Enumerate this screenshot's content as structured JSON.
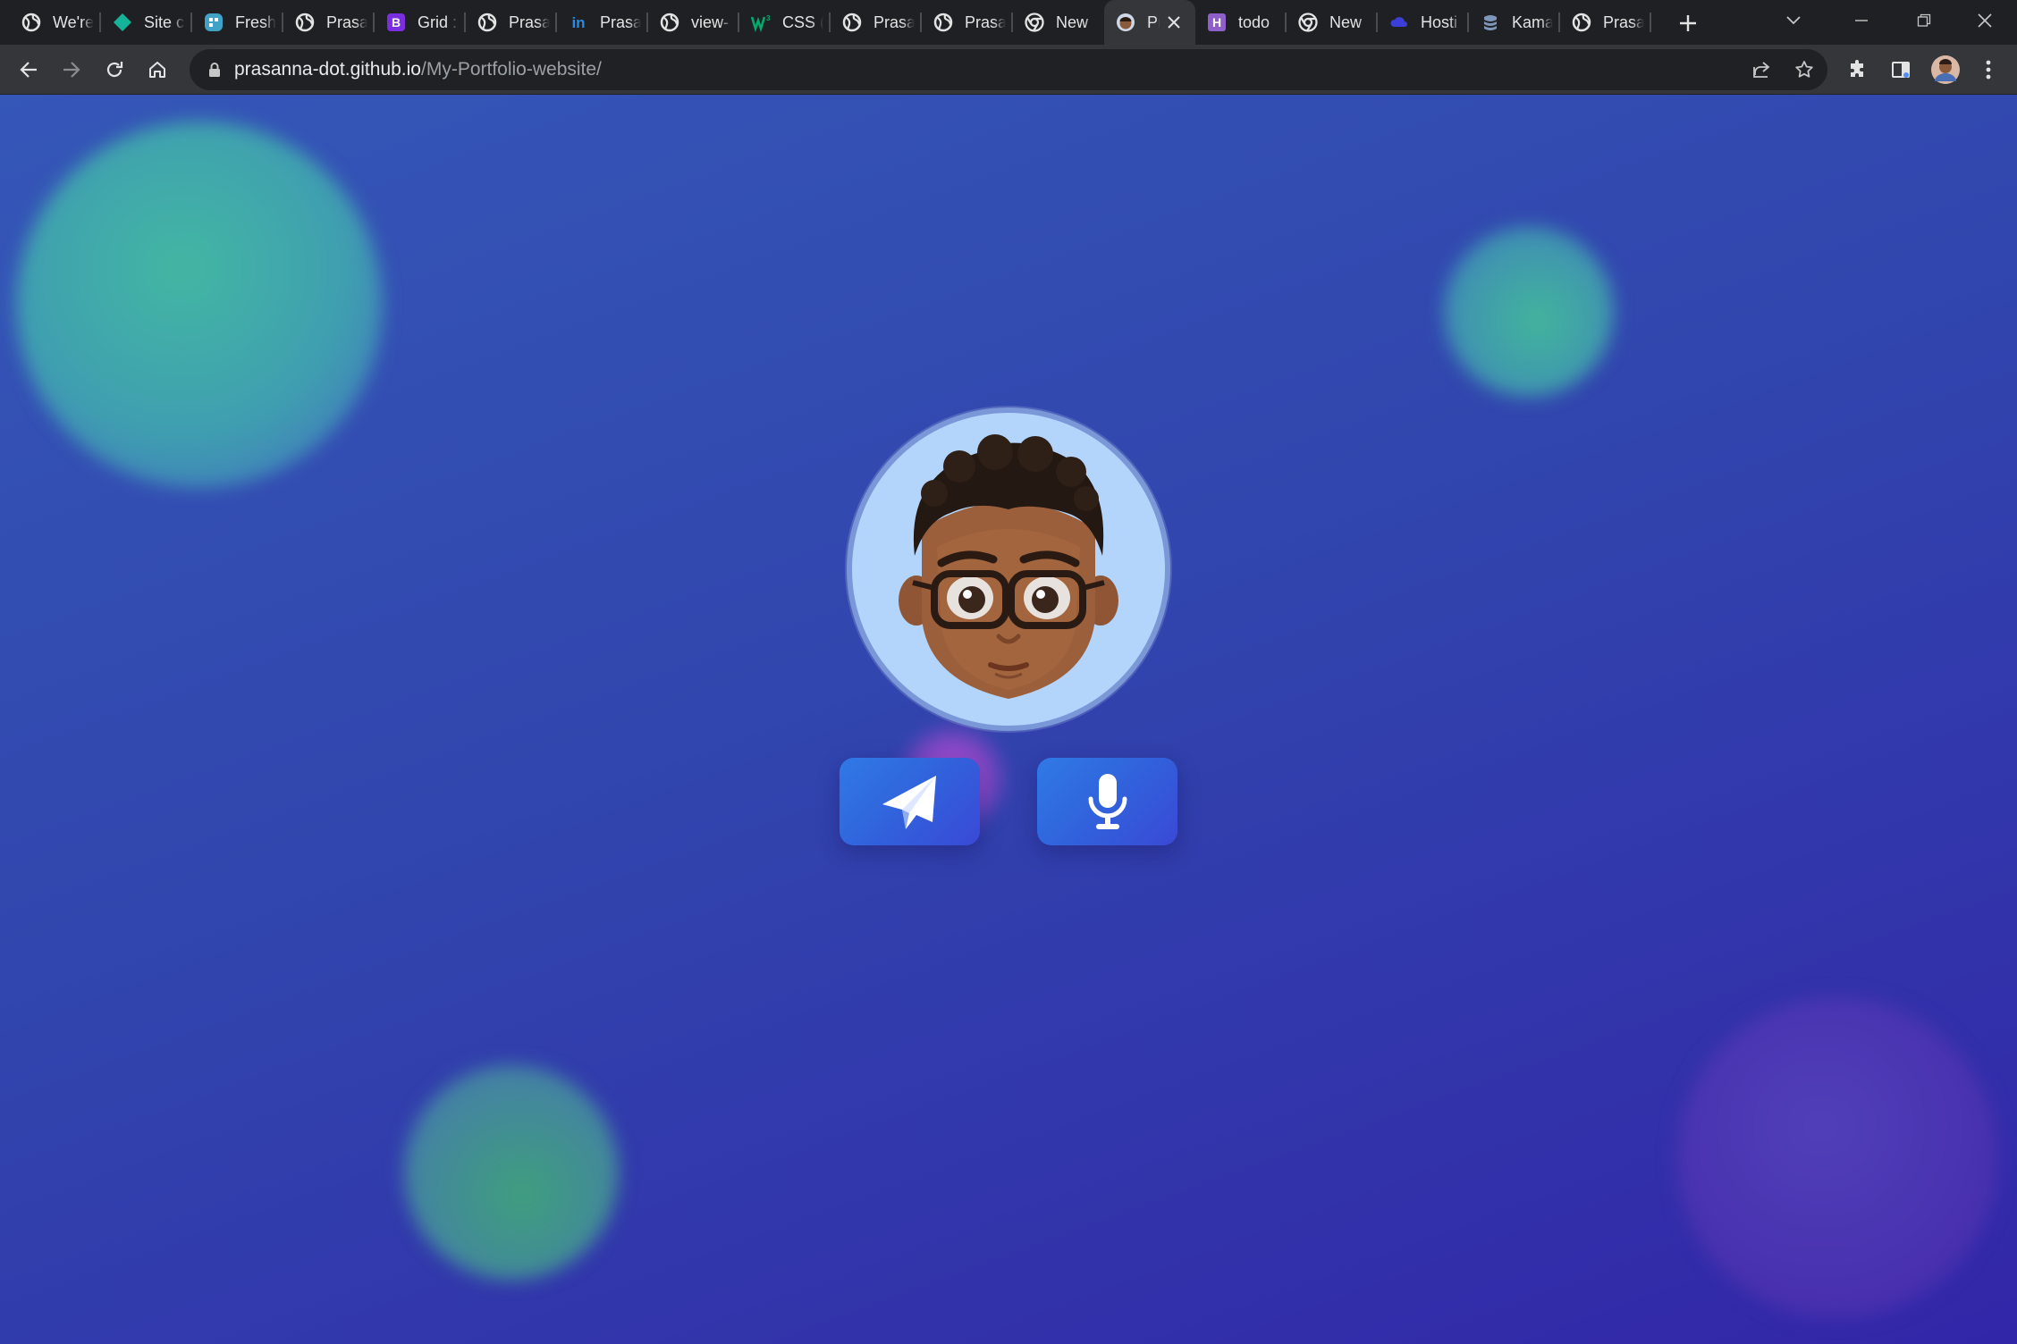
{
  "browser": {
    "tabs": [
      {
        "title": "We're",
        "icon": "globe-icon",
        "icon_color": "#e3e3e3"
      },
      {
        "title": "Site c",
        "icon": "diamond-icon",
        "icon_color": "#15b39a"
      },
      {
        "title": "Fresh",
        "icon": "freshworks-icon",
        "icon_color": "#3fa2c6"
      },
      {
        "title": "Prasa",
        "icon": "globe-icon",
        "icon_color": "#e3e3e3"
      },
      {
        "title": "Grid :",
        "icon": "bootstrap-icon",
        "icon_color": "#7b2ee0"
      },
      {
        "title": "Prasa",
        "icon": "globe-icon",
        "icon_color": "#e3e3e3"
      },
      {
        "title": "Prasa",
        "icon": "linkedin-icon",
        "icon_color": "#2a8be0"
      },
      {
        "title": "view-",
        "icon": "globe-icon",
        "icon_color": "#e3e3e3"
      },
      {
        "title": "CSS (",
        "icon": "w3schools-icon",
        "icon_color": "#04aa6d"
      },
      {
        "title": "Prasa",
        "icon": "globe-icon",
        "icon_color": "#e3e3e3"
      },
      {
        "title": "Prasa",
        "icon": "globe-icon",
        "icon_color": "#e3e3e3"
      },
      {
        "title": "New",
        "icon": "chrome-icon",
        "icon_color": "#e3e3e3"
      },
      {
        "title": "Pr",
        "icon": "avatar-favicon-icon",
        "icon_color": "#8a5a3c",
        "active": true
      },
      {
        "title": "todo",
        "icon": "hashnode-h-icon",
        "icon_color": "#8e5fc9"
      },
      {
        "title": "New",
        "icon": "chrome-icon",
        "icon_color": "#e3e3e3"
      },
      {
        "title": "Hosti",
        "icon": "cloud-icon",
        "icon_color": "#3b3fd6"
      },
      {
        "title": "Kama",
        "icon": "stack-icon",
        "icon_color": "#7e97b8"
      },
      {
        "title": "Prasa",
        "icon": "globe-icon",
        "icon_color": "#e3e3e3"
      }
    ],
    "address": {
      "domain": "prasanna-dot.github.io",
      "path": "/My-Portfolio-website/"
    }
  },
  "page": {
    "buttons": {
      "send_icon": "paper-plane-icon",
      "mic_icon": "microphone-icon"
    },
    "colors": {
      "background_top": "#3557b8",
      "background_bottom": "#3226a8",
      "button": "#3162dc",
      "avatar_bg": "#b4d5fb"
    }
  }
}
